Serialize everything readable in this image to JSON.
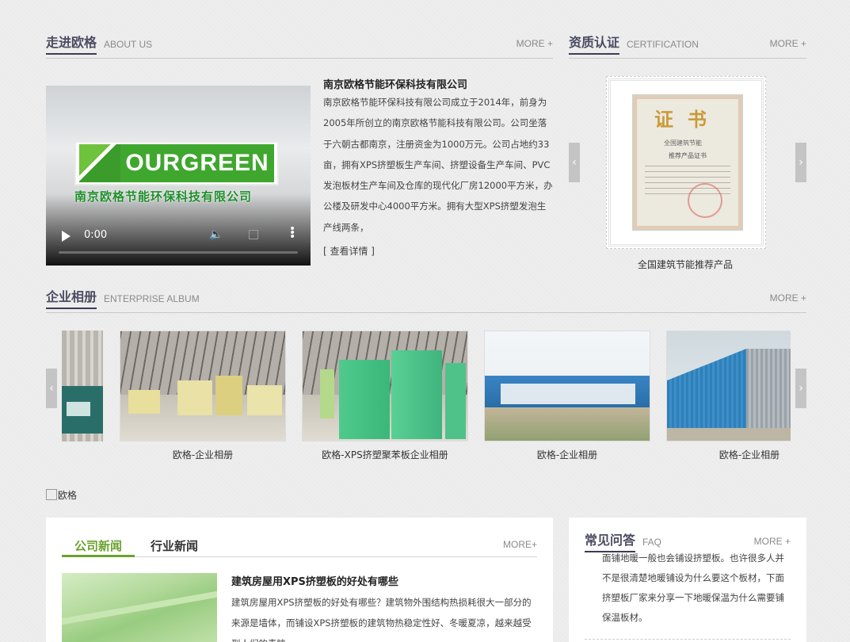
{
  "about": {
    "title_zh": "走进欧格",
    "title_en": "ABOUT US",
    "more": "MORE +",
    "company_name": "南京欧格节能环保科技有限公司",
    "description": "南京欧格节能环保科技有限公司成立于2014年，前身为2005年所创立的南京欧格节能科技有限公司。公司坐落于六朝古都南京，注册资金为1000万元。公司占地约33亩，拥有XPS挤塑板生产车间、挤塑设备生产车间、PVC发泡板材生产车间及仓库的现代化厂房12000平方米，办公楼及研发中心4000平方米。拥有大型XPS挤塑发泡生产线两条，",
    "details_link": "[ 查看详情 ]",
    "video": {
      "logo_word": "OURGREEN",
      "logo_company": "南京欧格节能环保科技有限公司",
      "time": "0:00"
    }
  },
  "certification": {
    "title_zh": "资质认证",
    "title_en": "CERTIFICATION",
    "more": "MORE +",
    "cert_heading": "证书",
    "cert_line1": "全国建筑节能",
    "cert_line2": "推荐产品证书",
    "caption": "全国建筑节能推荐产品",
    "prev_icon": "‹",
    "next_icon": "›"
  },
  "album": {
    "title_zh": "企业相册",
    "title_en": "ENTERPRISE ALBUM",
    "more": "MORE +",
    "items": [
      {
        "caption": "欧格-企业相册"
      },
      {
        "caption": "欧格-XPS挤塑聚苯板企业相册"
      },
      {
        "caption": "欧格-企业相册"
      },
      {
        "caption": "欧格-企业相册"
      }
    ],
    "prev_icon": "‹",
    "next_icon": "›"
  },
  "banner": {
    "alt": "欧格"
  },
  "news": {
    "tab_company": "公司新闻",
    "tab_industry": "行业新闻",
    "more": "MORE+",
    "article_title": "建筑房屋用XPS挤塑板的好处有哪些",
    "article_body": "建筑房屋用XPS挤塑板的好处有哪些？建筑物外围结构热损耗很大一部分的来源是墙体，而铺设XPS挤塑板的建筑物热稳定性好、冬暖夏凉，越来越受到人们的青睐"
  },
  "faq": {
    "title_zh": "常见问答",
    "title_en": "FAQ",
    "more": "MORE +",
    "text": "面铺地暖一般也会铺设挤塑板。也许很多人并不是很清楚地暖铺设为什么要这个板材，下面挤塑板厂家来分享一下地暖保温为什么需要铺保温板材。"
  }
}
